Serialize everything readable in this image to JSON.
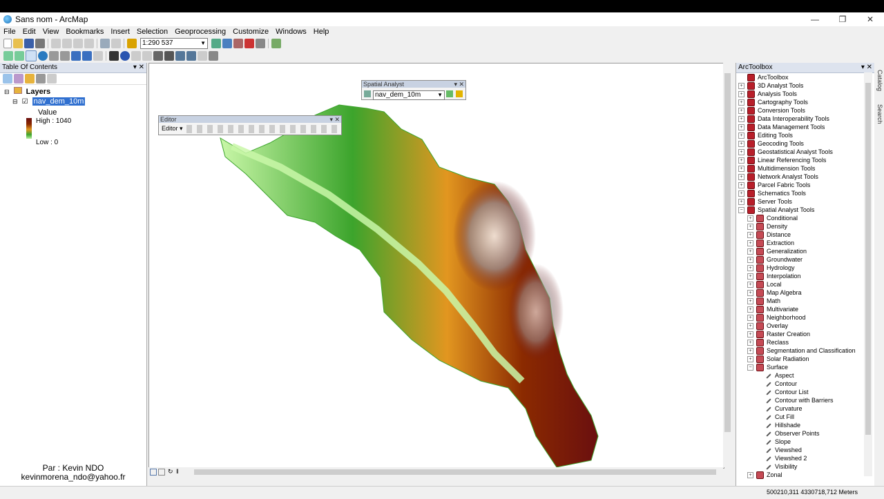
{
  "window": {
    "title": "Sans nom - ArcMap",
    "minimize": "—",
    "restore": "❐",
    "close": "✕"
  },
  "menu": [
    "File",
    "Edit",
    "View",
    "Bookmarks",
    "Insert",
    "Selection",
    "Geoprocessing",
    "Customize",
    "Windows",
    "Help"
  ],
  "toolbar": {
    "scale": "1:290 537"
  },
  "toc": {
    "title": "Table Of Contents",
    "layers_label": "Layers",
    "layer_name": "nav_dem_10m",
    "value_label": "Value",
    "high_label": "High : 1040",
    "low_label": "Low : 0"
  },
  "credit": {
    "author": "Par : Kevin NDO",
    "email": "kevinmorena_ndo@yahoo.fr"
  },
  "spatial_analyst": {
    "title": "Spatial Analyst",
    "layer": "nav_dem_10m"
  },
  "editor": {
    "title": "Editor",
    "menu": "Editor ▾"
  },
  "toolbox": {
    "title": "ArcToolbox",
    "root": "ArcToolbox",
    "toolboxes": [
      "3D Analyst Tools",
      "Analysis Tools",
      "Cartography Tools",
      "Conversion Tools",
      "Data Interoperability Tools",
      "Data Management Tools",
      "Editing Tools",
      "Geocoding Tools",
      "Geostatistical Analyst Tools",
      "Linear Referencing Tools",
      "Multidimension Tools",
      "Network Analyst Tools",
      "Parcel Fabric Tools",
      "Schematics Tools",
      "Server Tools",
      "Spatial Analyst Tools"
    ],
    "toolsets": [
      "Conditional",
      "Density",
      "Distance",
      "Extraction",
      "Generalization",
      "Groundwater",
      "Hydrology",
      "Interpolation",
      "Local",
      "Map Algebra",
      "Math",
      "Multivariate",
      "Neighborhood",
      "Overlay",
      "Raster Creation",
      "Reclass",
      "Segmentation and Classification",
      "Solar Radiation",
      "Surface"
    ],
    "surface_tools": [
      "Aspect",
      "Contour",
      "Contour List",
      "Contour with Barriers",
      "Curvature",
      "Cut Fill",
      "Hillshade",
      "Observer Points",
      "Slope",
      "Viewshed",
      "Viewshed 2",
      "Visibility"
    ],
    "last_toolset": "Zonal"
  },
  "side_tabs": [
    "Catalog",
    "Search"
  ],
  "status": {
    "coords": "500210,311  4330718,712 Meters"
  },
  "colors": {
    "dem_high": "#6a0f0f",
    "dem_mid": "#e29620",
    "dem_low": "#3ca42c",
    "dem_valley": "#c9f7a8",
    "toolbox_red": "#b81e2a",
    "selection": "#3070d0"
  }
}
